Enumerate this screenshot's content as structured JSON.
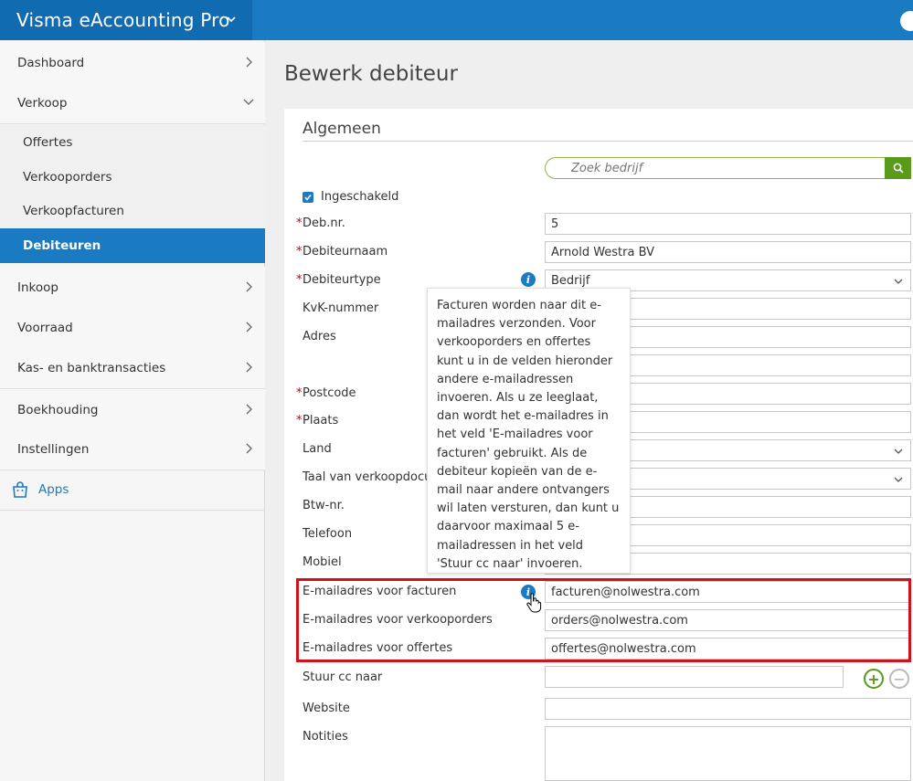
{
  "app": {
    "title": "Visma eAccounting Pro"
  },
  "sidebar": {
    "items": [
      {
        "label": "Dashboard"
      },
      {
        "label": "Verkoop"
      },
      {
        "label": "Inkoop"
      },
      {
        "label": "Voorraad"
      },
      {
        "label": "Kas- en banktransacties"
      },
      {
        "label": "Boekhouding"
      },
      {
        "label": "Instellingen"
      }
    ],
    "sub_items": [
      {
        "label": "Offertes"
      },
      {
        "label": "Verkooporders"
      },
      {
        "label": "Verkoopfacturen"
      },
      {
        "label": "Debiteuren",
        "active": true
      }
    ],
    "apps_label": "Apps"
  },
  "page": {
    "title": "Bewerk debiteur",
    "section": "Algemeen",
    "search_placeholder": "Zoek bedrijf",
    "enabled_label": "Ingeschakeld",
    "fields": {
      "debnr": {
        "label": "Deb.nr.",
        "value": "5"
      },
      "naam": {
        "label": "Debiteurnaam",
        "value": "Arnold Westra BV"
      },
      "type": {
        "label": "Debiteurtype",
        "value": "Bedrijf"
      },
      "kvk": {
        "label": "KvK-nummer",
        "value": ""
      },
      "adres": {
        "label": "Adres",
        "value": ""
      },
      "postcode": {
        "label": "Postcode",
        "value": ""
      },
      "plaats": {
        "label": "Plaats",
        "value": ""
      },
      "land": {
        "label": "Land",
        "value": ""
      },
      "taal": {
        "label": "Taal van verkoopdocur",
        "value": ""
      },
      "btw": {
        "label": "Btw-nr.",
        "value": ""
      },
      "telefoon": {
        "label": "Telefoon",
        "value": ""
      },
      "mobiel": {
        "label": "Mobiel",
        "value": ""
      },
      "email_facturen": {
        "label": "E-mailadres voor facturen",
        "value": "facturen@nolwestra.com"
      },
      "email_orders": {
        "label": "E-mailadres voor verkooporders",
        "value": "orders@nolwestra.com"
      },
      "email_offertes": {
        "label": "E-mailadres voor offertes",
        "value": "offertes@nolwestra.com"
      },
      "cc": {
        "label": "Stuur cc naar",
        "value": ""
      },
      "website": {
        "label": "Website",
        "value": ""
      },
      "notities": {
        "label": "Notities",
        "value": ""
      }
    },
    "tooltip": "Facturen worden naar dit e-mailadres verzonden. Voor verkooporders en offertes kunt u in de velden hieronder andere e-mailadressen invoeren. Als u ze leeglaat, dan wordt het e-mailadres in het veld 'E-mailadres voor facturen' gebruikt. Als de debiteur kopieën van de e-mail naar andere ontvangers wil laten versturen, dan kunt u daarvoor maximaal 5 e-mailadressen in het veld 'Stuur cc naar' invoeren.",
    "required_mark": "*"
  },
  "colors": {
    "brand": "#1a7ac2",
    "accent_green": "#5a9a1a",
    "highlight": "#d0121b"
  }
}
